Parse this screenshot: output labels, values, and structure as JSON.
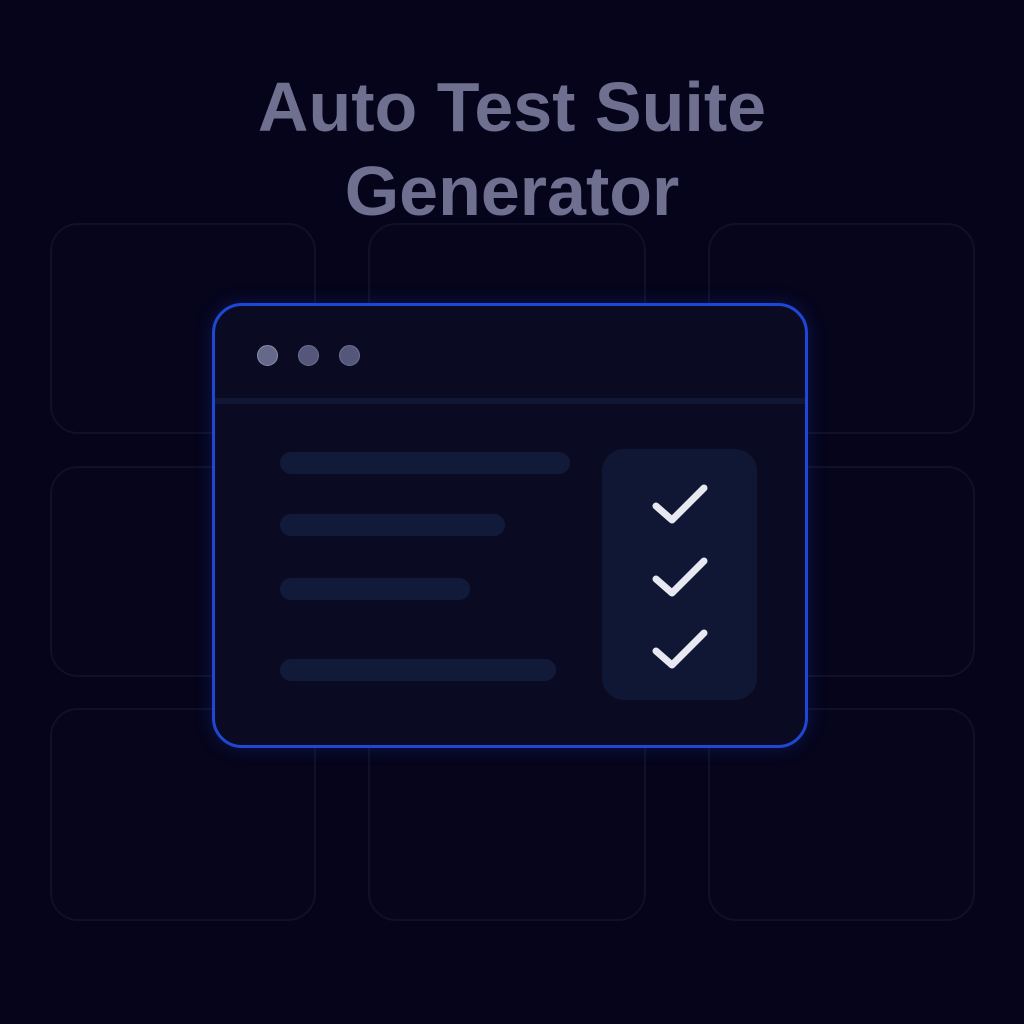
{
  "title": {
    "line1": "Auto Test Suite",
    "line2": "Generator"
  },
  "colors": {
    "background": "#05041a",
    "accent": "#1f47d6",
    "check": "#e8e8f2"
  },
  "window": {
    "dots": [
      "dot-1",
      "dot-2",
      "dot-3"
    ],
    "checks": [
      "check-icon",
      "check-icon",
      "check-icon"
    ]
  }
}
